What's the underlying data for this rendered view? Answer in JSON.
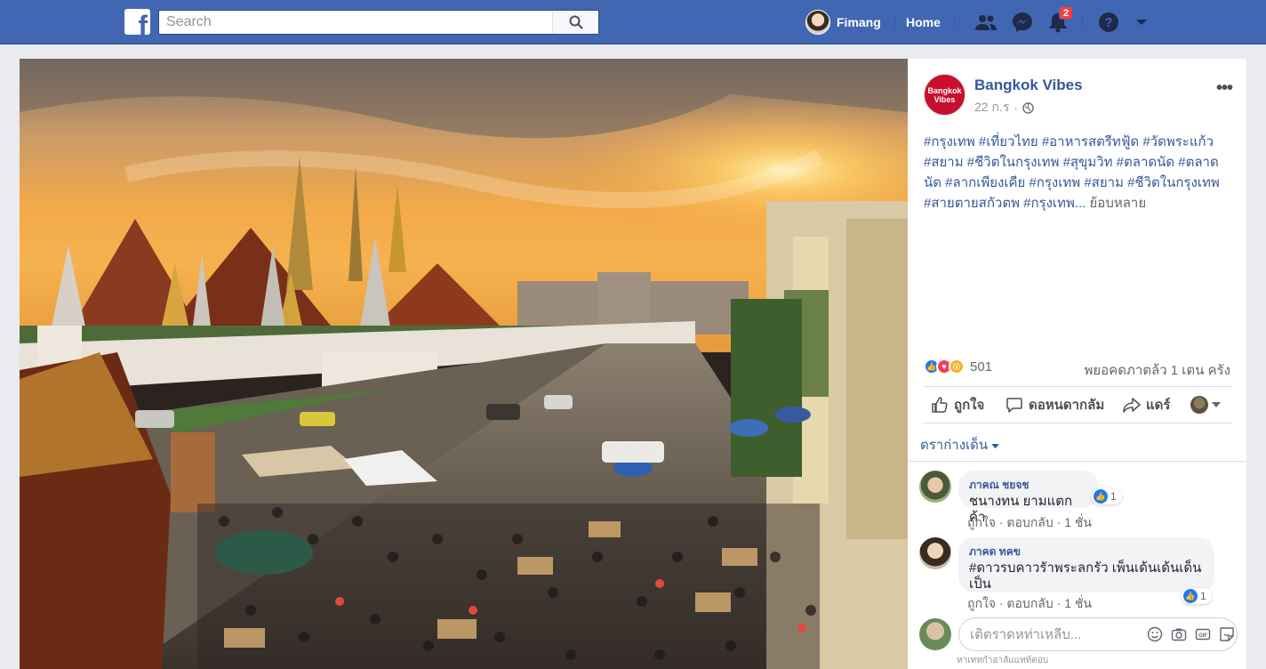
{
  "topbar": {
    "logo_letter": "f",
    "search_placeholder": "Search",
    "user_name": "Fimang",
    "home_label": "Home",
    "notifications_count": "2",
    "brand_color": "#4267b2"
  },
  "post": {
    "page_avatar_text": "Bangkok Vibes",
    "page_name": "Bangkok Vibes",
    "timestamp": "22 ก.ร",
    "visibility_icon": "globe-icon",
    "hashtags": "#กรุงเทพ #เที่ยวไทย #อาหารสตรีทฟู้ด #วัดพระแก้ว #สยาม #ชีวิตในกรุงเทพ #สุขุมวิท #ตลาดนัด #ตลาดนัด #ลากเพียงเคีย #กรุงเทพ #สยาม #ชีวิตในกรุงเทพ #สายตายสกัวตพ #กรุงเทพ...",
    "see_more": "ย้อบหลาย",
    "reaction_count": "501",
    "views": "พยอคดภาตล้ว 1 เตน ครัง",
    "actions": {
      "like": "ถูกใจ",
      "comment": "ดอหนดากลัม",
      "share": "แดร์"
    }
  },
  "comments_section": {
    "sort_label": "ดราก่างเด็น",
    "comments": [
      {
        "author": "ภาคณ ชยจช",
        "text": "ชนางทน ยามแตกค้า",
        "likes": "1",
        "meta": "ถูกใจ · ตอบกลับ · 1 ชั่น"
      },
      {
        "author": "ภาคด ทคข",
        "text": "#ดาวรบคาวรัาพระลกรัว เพ็นเด้นเด้นเด็นเป็น",
        "likes": "1",
        "meta": "ถูกใจ · ตอบกลับ · 1 ชั่น"
      }
    ],
    "write_placeholder": "เติตราดหท่าเหลีบ...",
    "write_hint": "หาเททกำอาลัแแทท้ดอบ"
  }
}
